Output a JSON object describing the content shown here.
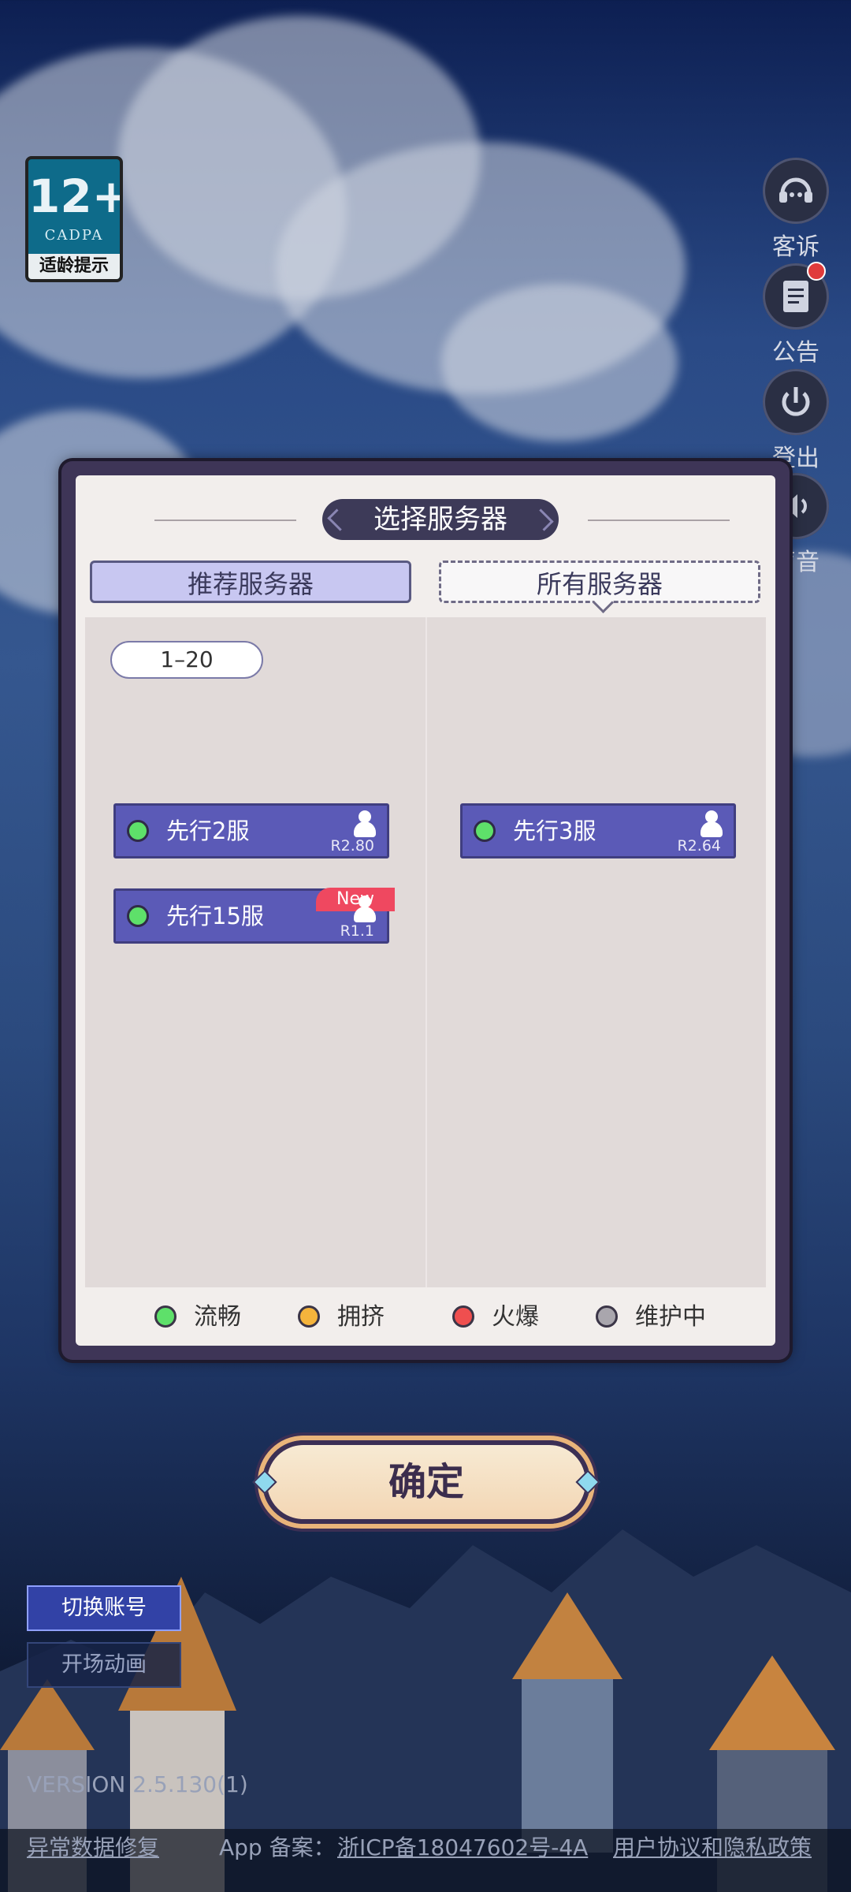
{
  "age_rating": {
    "number": "12+",
    "org": "CADPA",
    "tip": "适龄提示"
  },
  "side_menu": [
    {
      "label": "客诉",
      "icon": "headset-icon"
    },
    {
      "label": "公告",
      "icon": "notice-icon",
      "has_badge": true
    },
    {
      "label": "登出",
      "icon": "power-icon"
    },
    {
      "label": "声音",
      "icon": "sound-icon"
    }
  ],
  "dialog": {
    "title": "选择服务器",
    "tabs": {
      "recommend": "推荐服务器",
      "all": "所有服务器"
    },
    "range_chip": "1–20",
    "servers": [
      {
        "name": "先行2服",
        "version": "R2.80",
        "status": "green"
      },
      {
        "name": "先行3服",
        "version": "R2.64",
        "status": "green"
      },
      {
        "name": "先行15服",
        "version": "R1.1",
        "status": "green",
        "tag": "New"
      }
    ],
    "legend": [
      {
        "label": "流畅",
        "color": "#5ee06a"
      },
      {
        "label": "拥挤",
        "color": "#f5b43c"
      },
      {
        "label": "火爆",
        "color": "#ef4f4f"
      },
      {
        "label": "维护中",
        "color": "#a9a6ad"
      }
    ]
  },
  "confirm_label": "确定",
  "buttons": {
    "switch_account": "切换账号",
    "opening_animation": "开场动画"
  },
  "footer": {
    "version": "VERSION 2.5.130(1)",
    "repair": "异常数据修复",
    "record_label": "App 备案：",
    "record_number": "浙ICP备18047602号-4A",
    "policy": "用户协议和隐私政策"
  }
}
